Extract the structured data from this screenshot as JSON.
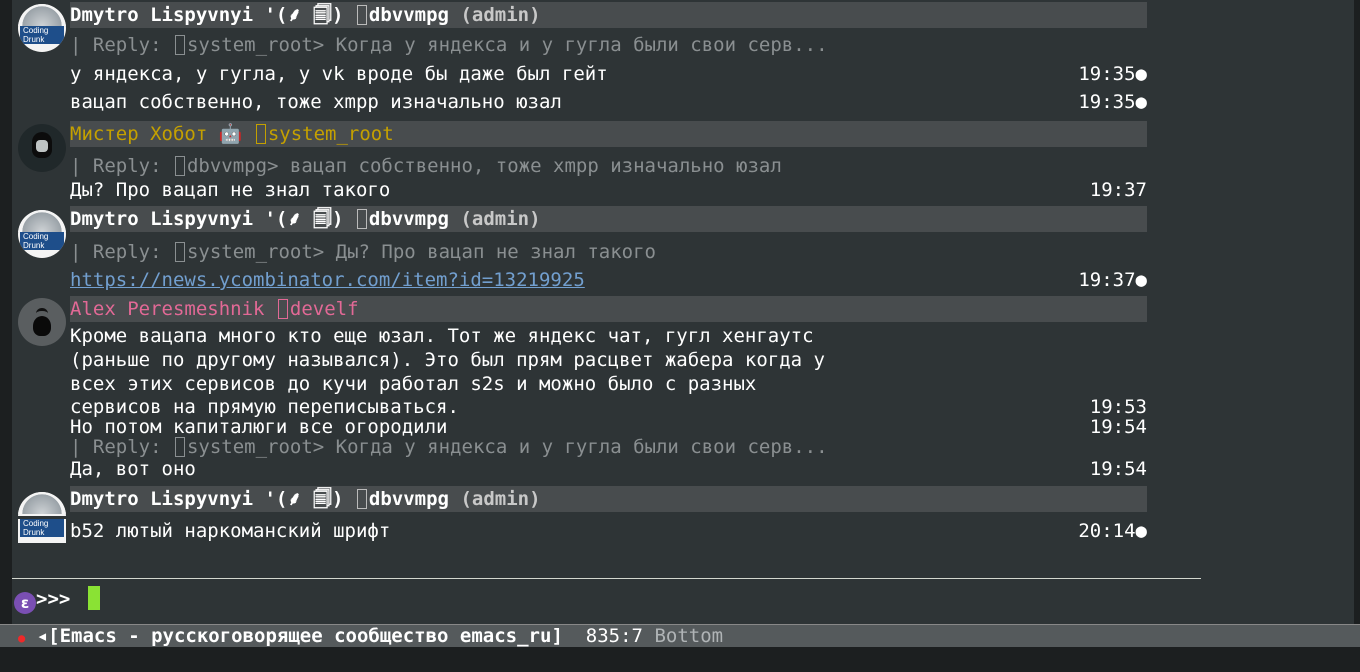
{
  "messages": [
    {
      "author": "Dmytro Lispyvnyi '(⸙ 📱)",
      "nick": "dbvvmpg",
      "role": "(admin)"
    },
    {
      "reply": "| Reply:  system_root> Когда у яндекса и у гугла были свои серв..."
    }
  ],
  "m1": {
    "author": "Dmytro Lispyvnyi '(⸙ 🗐)",
    "nick": "dbvvmpg",
    "role": "(admin)",
    "reply_prefix": "| Reply: ",
    "reply_nick": "system_root> ",
    "reply_text": "Когда у яндекса и у гугла были свои серв...",
    "line1": "у яндекса, у гугла, у vk вроде бы даже был гейт",
    "time1": "19:35●",
    "line2": "вацап собственно, тоже xmpp изначально юзал",
    "time2": "19:35●"
  },
  "m2": {
    "author": "Мистер Хобот 🤖",
    "nick": "system_root",
    "reply_prefix": "| Reply: ",
    "reply_nick": "dbvvmpg> ",
    "reply_text": "вацап собственно, тоже xmpp изначально юзал",
    "line1": "Ды? Про вацап не знал такого",
    "time1": "19:37"
  },
  "m3": {
    "author": "Dmytro Lispyvnyi '(⸙ 🗐)",
    "nick": "dbvvmpg",
    "role": "(admin)",
    "reply_prefix": "| Reply: ",
    "reply_nick": "system_root> ",
    "reply_text": "Ды? Про вацап не знал такого",
    "link": "https://news.ycombinator.com/item?id=13219925",
    "time1": "19:37●"
  },
  "m4": {
    "author": "Alex Peresmeshnik",
    "nick": "develf",
    "text1": "Кроме вацапа много кто еще юзал. Тот же яндекс чат, гугл хенгаутс",
    "text2": "(раньше по другому назывался). Это был прям расцвет жабера когда у",
    "text3": "всех этих сервисов до кучи работал s2s и можно было с разных",
    "text4": "сервисов на прямую переписываться.",
    "time1": "19:53",
    "text5": "Но потом капиталюги все огородили",
    "time2": "19:54",
    "reply_prefix": "| Reply: ",
    "reply_nick": "system_root> ",
    "reply_text": "Когда у яндекса и у гугла были свои серв...",
    "text6": "Да, вот оно",
    "time3": "19:54"
  },
  "m5": {
    "author": "Dmytro Lispyvnyi '(⸙ 🗐)",
    "nick": "dbvvmpg",
    "role": "(admin)",
    "line1": "b52 лютый наркоманский шрифт",
    "time1": "20:14●"
  },
  "avatar_text": {
    "coding": "Coding",
    "drunk": "Drunk"
  },
  "prompt": {
    "icon": "ε",
    "text": ">>> "
  },
  "modeline": {
    "dot": "●",
    "arrow": " ◂",
    "buffer": "[Emacs - русскоговорящее сообщество emacs_ru]",
    "position": "835:7",
    "where": "Bottom"
  },
  "colors": {
    "bg": "#2e3436",
    "header": "#484c4e",
    "yellow": "#c4a000",
    "pink": "#e26996",
    "link": "#729fcf",
    "cursor": "#8ae234"
  }
}
